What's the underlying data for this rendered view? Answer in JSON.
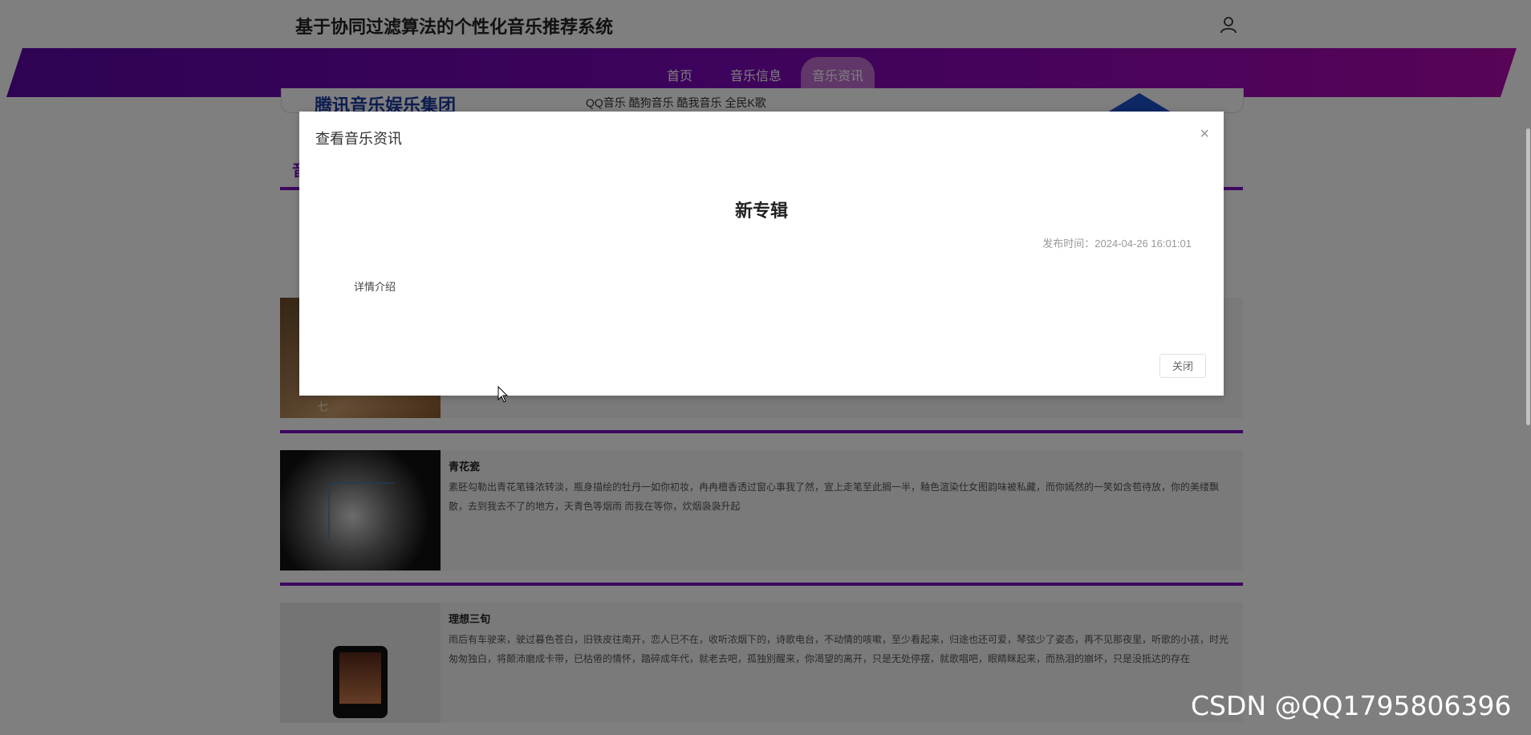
{
  "header": {
    "site_title": "基于协同过滤算法的个性化音乐推荐系统"
  },
  "nav": {
    "items": [
      "首页",
      "音乐信息",
      "音乐资讯"
    ],
    "active": "音乐资讯"
  },
  "banner": {
    "logo_text": "腾讯音乐娱乐集团",
    "apps_text": "QQ音乐 酷狗音乐 酷我音乐 全民K歌"
  },
  "section": {
    "tab_label": "音"
  },
  "news": [
    {
      "title": "",
      "description": "",
      "image_text": "七"
    },
    {
      "title": "青花瓷",
      "description": "素胚勾勒出青花笔锋浓转淡，瓶身描绘的牡丹一如你初妆，冉冉檀香透过窗心事我了然，宣上走笔至此搁一半，釉色渲染仕女图韵味被私藏，而你嫣然的一笑如含苞待放，你的美缕飘散，去到我去不了的地方，天青色等烟雨 而我在等你，炊烟袅袅升起"
    },
    {
      "title": "理想三旬",
      "description": "雨后有车驶来，驶过暮色苍白，旧铁皮往南开，恋人已不在，收听浓烟下的，诗歌电台，不动情的咳嗽，至少看起来，归途也还可爱，琴弦少了姿态，再不见那夜里，听歌的小孩，时光匆匆独白，将颠沛磨成卡带，已枯倦的情怀，踏碎成年代，就老去吧，孤独别醒来，你渴望的离开，只是无处停摆，就歌唱吧，眼睛眯起来，而热泪的崩坏，只是没抵达的存在"
    }
  ],
  "modal": {
    "title": "查看音乐资讯",
    "article_title": "新专辑",
    "publish_label": "发布时间：",
    "publish_value": "2024-04-26 16:01:01",
    "detail_text": "详情介绍",
    "close_label": "关闭",
    "close_icon": "×"
  },
  "watermark": "CSDN @QQ1795806396",
  "colors": {
    "nav_gradient_start": "#5b06a8",
    "nav_gradient_end": "#b108ae",
    "accent": "#7b10c0"
  }
}
